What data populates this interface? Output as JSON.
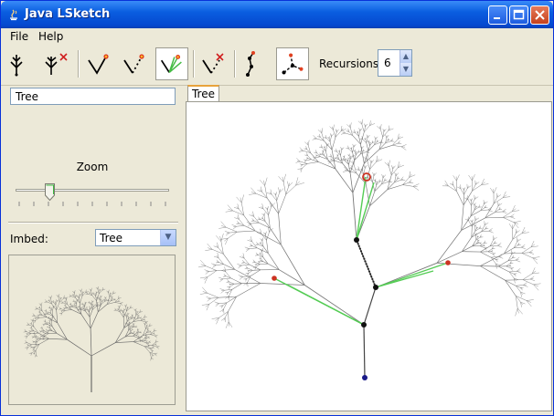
{
  "window": {
    "title": "Java LSketch"
  },
  "menu": {
    "file": "File",
    "help": "Help"
  },
  "toolbar": {
    "recursions_label": "Recursions:",
    "recursions_value": "6"
  },
  "left_panel": {
    "name_value": "Tree",
    "zoom_label": "Zoom",
    "zoom_level": 0.22,
    "imbed_label": "Imbed:",
    "imbed_value": "Tree"
  },
  "canvas": {
    "tab_label": "Tree"
  },
  "colors": {
    "branch": "#777777",
    "highlight": "#55cc55",
    "node": "#111111",
    "handle": "#cc3322",
    "root": "#1a1a88",
    "accent": "#e8a33c"
  }
}
